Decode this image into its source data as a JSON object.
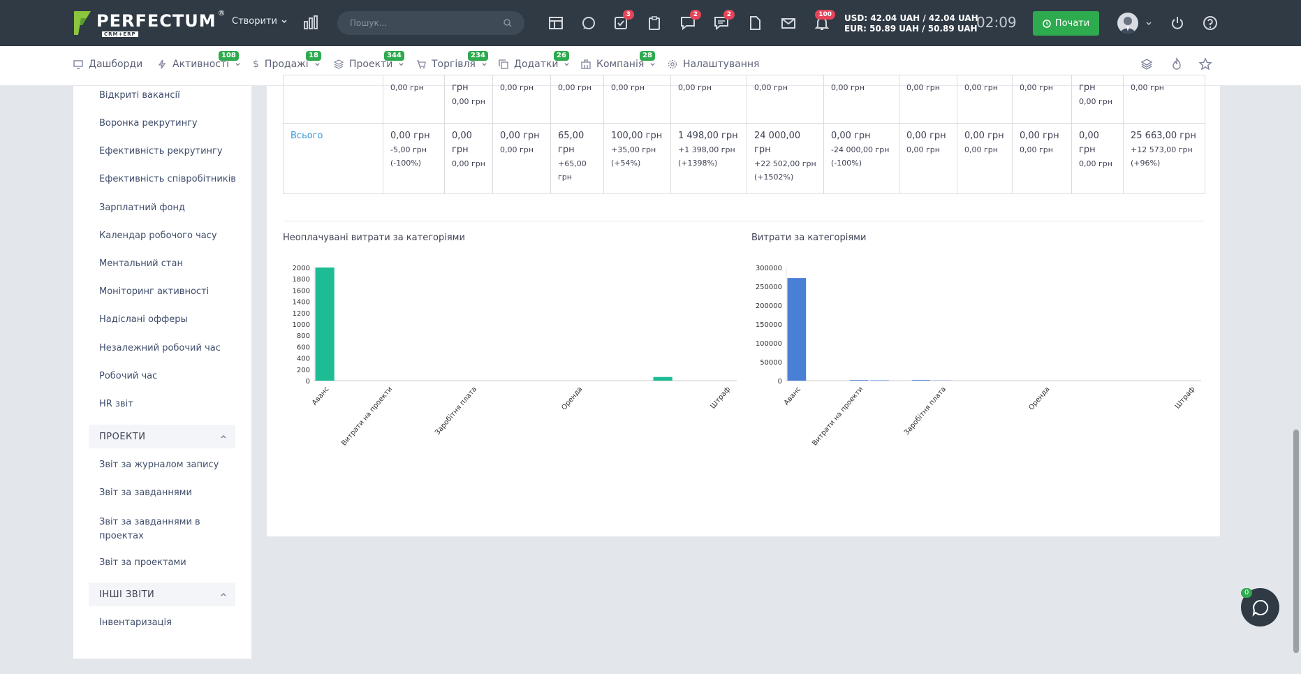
{
  "topbar": {
    "logo_text": "PERFECTUM",
    "logo_reg": "®",
    "logo_sub": "CRM+ERP",
    "create_label": "Створити",
    "search_placeholder": "Пошук...",
    "badges": {
      "tasks": "3",
      "chat": "2",
      "messages": "2",
      "notifications": "100"
    },
    "rate_usd": "USD: 42.04 UAH / 42.04 UAH",
    "rate_eur": "EUR: 50.89 UAH / 50.89 UAH",
    "clock": "02:09",
    "start_label": "Почати"
  },
  "nav": {
    "items": [
      {
        "label": "Дашборди",
        "badge": ""
      },
      {
        "label": "Активності",
        "badge": "108"
      },
      {
        "label": "Продажі",
        "badge": "18"
      },
      {
        "label": "Проекти",
        "badge": "344"
      },
      {
        "label": "Торгівля",
        "badge": "234"
      },
      {
        "label": "Додатки",
        "badge": "26"
      },
      {
        "label": "Компанія",
        "badge": "28"
      },
      {
        "label": "Налаштування",
        "badge": ""
      }
    ]
  },
  "sidebar": {
    "links_hr": [
      "Відкриті вакансії",
      "Воронка рекрутингу",
      "Ефективність рекрутингу",
      "Ефективність співробітників",
      "Зарплатний фонд",
      "Календар робочого часу",
      "Ментальний стан",
      "Моніторинг активності",
      "Надіслані офферы",
      "Незалежний робочий час",
      "Робочий час",
      "HR звіт"
    ],
    "section_projects": "ПРОЕКТИ",
    "links_projects": [
      "Звіт за журналом запису",
      "Звіт за завданнями",
      "Звіт за завданнями в",
      "проектах",
      "Звіт за проектами"
    ],
    "section_other": "ІНШІ ЗВІТИ",
    "links_other": [
      "Інвентаризація"
    ]
  },
  "table": {
    "row1": [
      "",
      "0,00 грн",
      "грн",
      "0,00 грн",
      "0,00 грн",
      "0,00 грн",
      "0,00 грн",
      "0,00 грн",
      "0,00 грн",
      "0,00 грн",
      "0,00 грн",
      "0,00 грн",
      "грн",
      "0,00 грн"
    ],
    "row1_sub": [
      "",
      "",
      "0,00 грн",
      "",
      "",
      "",
      "",
      "",
      "",
      "",
      "",
      "",
      "0,00 грн",
      ""
    ],
    "row2_label": "Всього",
    "row2": [
      [
        "0,00 грн",
        "-5,00 грн",
        "(-100%)"
      ],
      [
        "0,00",
        "грн",
        "0,00 грн"
      ],
      [
        "0,00 грн",
        "0,00 грн",
        ""
      ],
      [
        "65,00",
        "грн",
        "+65,00",
        "грн"
      ],
      [
        "100,00 грн",
        "+35,00 грн",
        "(+54%)"
      ],
      [
        "1 498,00 грн",
        "+1 398,00 грн",
        "(+1398%)"
      ],
      [
        "24 000,00 грн",
        "+22 502,00 грн",
        "(+1502%)"
      ],
      [
        "0,00 грн",
        "-24 000,00 грн",
        "(-100%)"
      ],
      [
        "0,00 грн",
        "0,00 грн",
        ""
      ],
      [
        "0,00 грн",
        "0,00 грн",
        ""
      ],
      [
        "0,00 грн",
        "0,00 грн",
        ""
      ],
      [
        "0,00",
        "грн",
        "0,00 грн"
      ],
      [
        "25 663,00 грн",
        "+12 573,00 грн",
        "(+96%)"
      ]
    ]
  },
  "chart_data": [
    {
      "type": "bar",
      "title": "Неоплачувані витрати за категоріями",
      "categories": [
        "Аванс",
        "",
        "",
        "Витрати на проекти",
        "",
        "",
        "",
        "Заробітня плата",
        "",
        "",
        "",
        "",
        "Оренда",
        "",
        "",
        "",
        "",
        "",
        "",
        "Штраф"
      ],
      "tick_labels": [
        "Аванс",
        "Витрати на проекти",
        "Заробітня плата",
        "Оренда",
        "Штраф"
      ],
      "values": [
        2000,
        0,
        0,
        0,
        0,
        0,
        0,
        0,
        0,
        0,
        0,
        0,
        0,
        0,
        0,
        0,
        65,
        0,
        0,
        0
      ],
      "ylim": [
        0,
        2000
      ],
      "yticks": [
        0,
        200,
        400,
        600,
        800,
        1000,
        1200,
        1400,
        1600,
        1800,
        2000
      ],
      "color": "#1dbc94"
    },
    {
      "type": "bar",
      "title": "Витрати за категоріями",
      "categories": [
        "Аванс",
        "",
        "",
        "Витрати на проекти",
        "",
        "",
        "",
        "Заробітня плата",
        "",
        "",
        "",
        "",
        "Оренда",
        "",
        "",
        "",
        "",
        "",
        "",
        "Штраф"
      ],
      "tick_labels": [
        "Аванс",
        "Витрати на проекти",
        "Заробітня плата",
        "Оренда",
        "Штраф"
      ],
      "values": [
        272000,
        0,
        0,
        1500,
        1000,
        0,
        1500,
        500,
        0,
        0,
        0,
        0,
        0,
        0,
        0,
        0,
        0,
        0,
        0,
        0
      ],
      "ylim": [
        0,
        300000
      ],
      "yticks": [
        0,
        50000,
        100000,
        150000,
        200000,
        250000,
        300000
      ],
      "color": "#4a7fd6"
    }
  ],
  "chat": {
    "badge": "0"
  }
}
